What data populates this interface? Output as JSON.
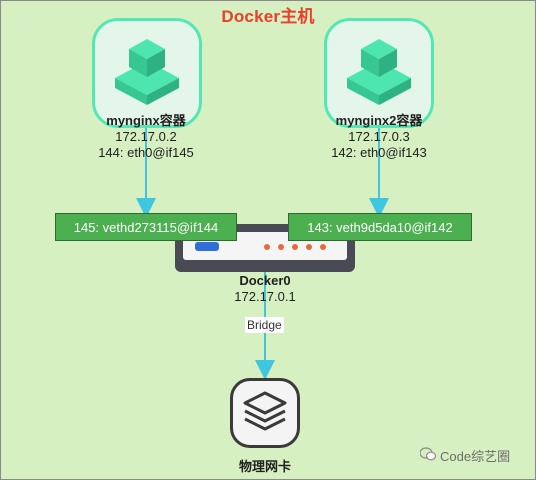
{
  "title": "Docker主机",
  "containers": [
    {
      "name": "mynginx容器",
      "ip": "172.17.0.2",
      "iface": "144: eth0@if145"
    },
    {
      "name": "mynginx2容器",
      "ip": "172.17.0.3",
      "iface": "142: eth0@if143"
    }
  ],
  "veths": [
    {
      "label": "145: vethd273115@if144"
    },
    {
      "label": "143: veth9d5da10@if142"
    }
  ],
  "bridge": {
    "name": "Docker0",
    "ip": "172.17.0.1",
    "link_label": "Bridge"
  },
  "nic": {
    "label": "物理网卡"
  },
  "watermark": "Code综艺圈",
  "colors": {
    "background": "#d6f0c2",
    "title": "#e8402a",
    "container_icon": "#52e8b4",
    "veth_fill": "#4caf50",
    "arrow": "#3fc6e0"
  },
  "icons": {
    "container": "cube-stack-icon",
    "bridge": "router-switch-icon",
    "nic": "layers-stack-icon",
    "watermark": "wechat-icon"
  }
}
